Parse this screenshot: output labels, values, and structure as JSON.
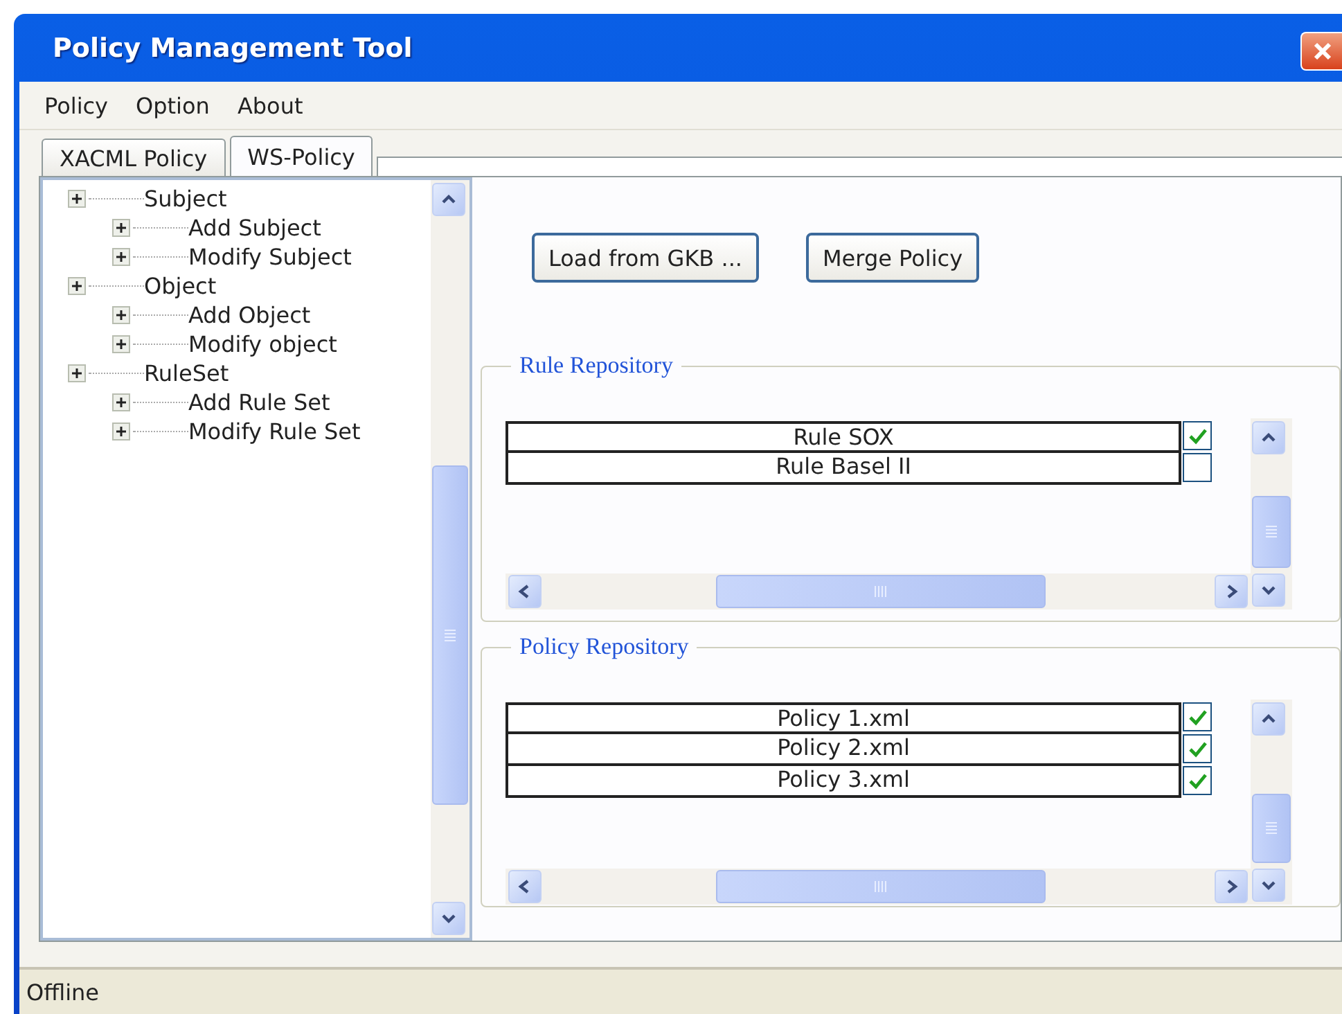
{
  "window": {
    "title": "Policy Management Tool"
  },
  "menu": [
    "Policy",
    "Option",
    "About"
  ],
  "tabs": [
    {
      "label": "XACML Policy",
      "selected": false
    },
    {
      "label": "WS-Policy",
      "selected": true
    }
  ],
  "tree": [
    {
      "label": "Subject",
      "children": [
        {
          "label": "Add Subject"
        },
        {
          "label": "Modify Subject"
        }
      ]
    },
    {
      "label": "Object",
      "children": [
        {
          "label": "Add Object"
        },
        {
          "label": "Modify object"
        }
      ]
    },
    {
      "label": "RuleSet",
      "children": [
        {
          "label": "Add Rule Set"
        },
        {
          "label": "Modify Rule Set"
        }
      ]
    }
  ],
  "buttons": [
    "Load from GKB ...",
    "Merge Policy"
  ],
  "repositories": [
    {
      "title": "Rule Repository",
      "items": [
        {
          "label": "Rule SOX",
          "checked": true
        },
        {
          "label": "Rule Basel II",
          "checked": false
        }
      ]
    },
    {
      "title": "Policy Repository",
      "items": [
        {
          "label": "Policy 1.xml",
          "checked": true
        },
        {
          "label": "Policy 2.xml",
          "checked": true
        },
        {
          "label": "Policy 3.xml",
          "checked": true
        }
      ]
    }
  ],
  "status_bar": "Offline"
}
